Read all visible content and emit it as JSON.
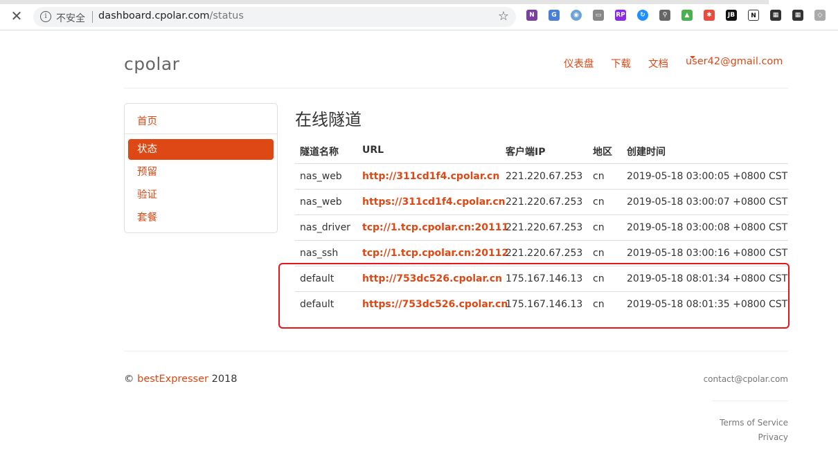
{
  "browser": {
    "insecure_label": "不安全",
    "url_host": "dashboard.cpolar.com",
    "url_path": "/status"
  },
  "header": {
    "logo": "cpolar",
    "nav": [
      "仪表盘",
      "下载",
      "文档"
    ],
    "user_email": "user42@gmail.com"
  },
  "sidebar": {
    "home": "首页",
    "items": [
      "状态",
      "预留",
      "验证",
      "套餐"
    ],
    "active_index": 0
  },
  "main": {
    "title": "在线隧道",
    "columns": [
      "隧道名称",
      "URL",
      "客户端IP",
      "地区",
      "创建时间"
    ],
    "rows": [
      {
        "name": "nas_web",
        "url": "http://311cd1f4.cpolar.cn",
        "ip": "221.220.67.253",
        "region": "cn",
        "created": "2019-05-18 03:00:05 +0800 CST"
      },
      {
        "name": "nas_web",
        "url": "https://311cd1f4.cpolar.cn",
        "ip": "221.220.67.253",
        "region": "cn",
        "created": "2019-05-18 03:00:07 +0800 CST"
      },
      {
        "name": "nas_driver",
        "url": "tcp://1.tcp.cpolar.cn:20111",
        "ip": "221.220.67.253",
        "region": "cn",
        "created": "2019-05-18 03:00:08 +0800 CST"
      },
      {
        "name": "nas_ssh",
        "url": "tcp://1.tcp.cpolar.cn:20112",
        "ip": "221.220.67.253",
        "region": "cn",
        "created": "2019-05-18 03:00:16 +0800 CST"
      },
      {
        "name": "default",
        "url": "http://753dc526.cpolar.cn",
        "ip": "175.167.146.13",
        "region": "cn",
        "created": "2019-05-18 08:01:34 +0800 CST"
      },
      {
        "name": "default",
        "url": "https://753dc526.cpolar.cn",
        "ip": "175.167.146.13",
        "region": "cn",
        "created": "2019-05-18 08:01:35 +0800 CST"
      }
    ]
  },
  "footer": {
    "copyright_symbol": "©",
    "copyright_link": "bestExpresser",
    "copyright_year": "2018",
    "contact": "contact@cpolar.com",
    "terms": "Terms of Service",
    "privacy": "Privacy"
  },
  "colors": {
    "accent": "#dd4814",
    "highlight_border": "#e8141c"
  }
}
